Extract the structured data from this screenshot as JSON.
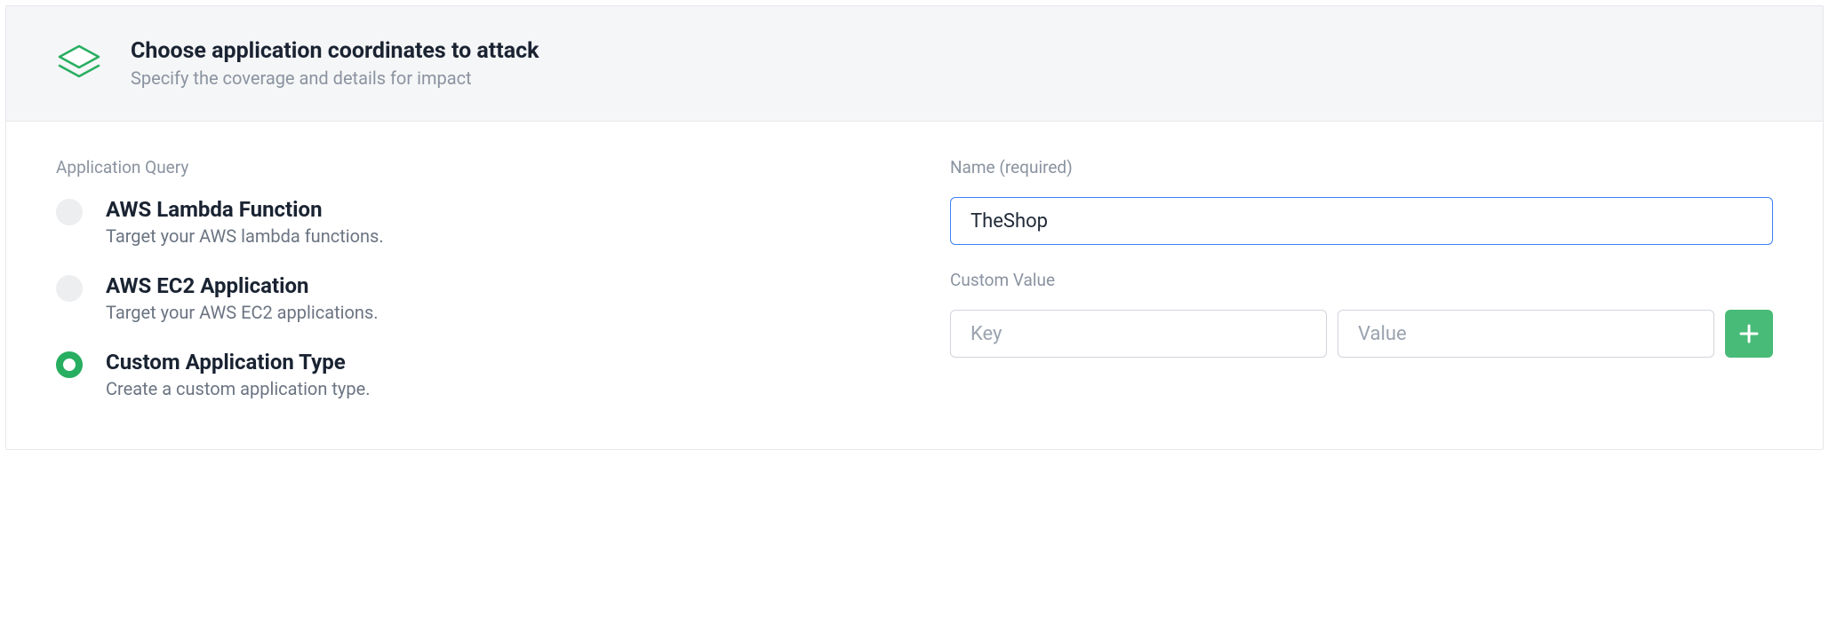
{
  "header": {
    "title": "Choose application coordinates to attack",
    "subtitle": "Specify the coverage and details for impact"
  },
  "left": {
    "label": "Application Query",
    "options": [
      {
        "title": "AWS Lambda Function",
        "desc": "Target your AWS lambda functions.",
        "selected": false
      },
      {
        "title": "AWS EC2 Application",
        "desc": "Target your AWS EC2 applications.",
        "selected": false
      },
      {
        "title": "Custom Application Type",
        "desc": "Create a custom application type.",
        "selected": true
      }
    ]
  },
  "right": {
    "nameLabel": "Name (required)",
    "nameValue": "TheShop",
    "customValueLabel": "Custom Value",
    "keyPlaceholder": "Key",
    "valuePlaceholder": "Value"
  }
}
